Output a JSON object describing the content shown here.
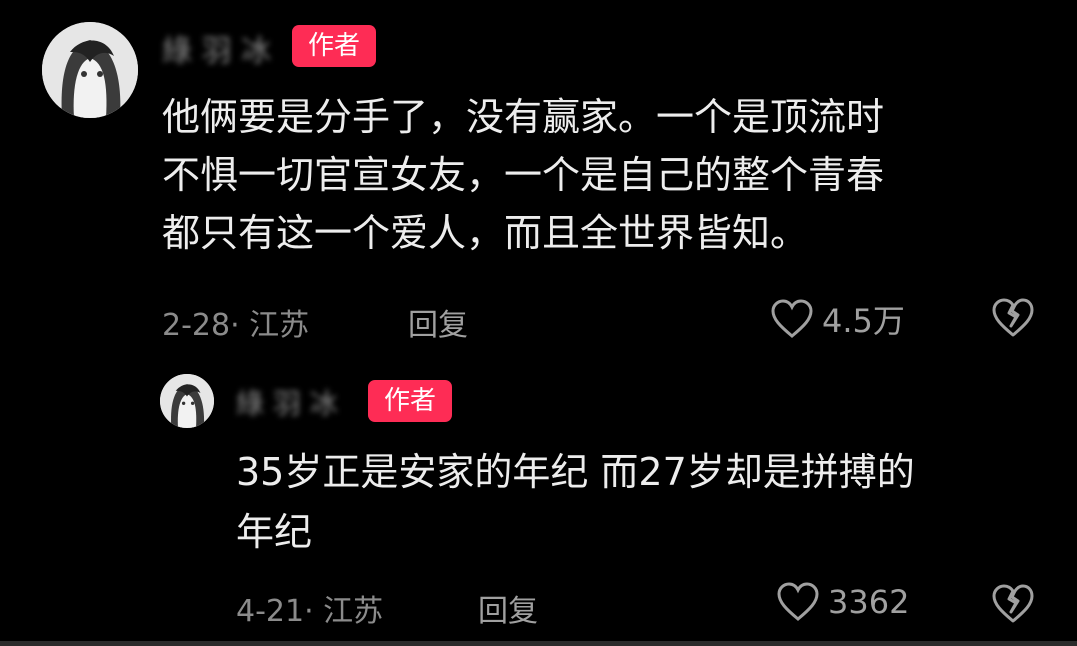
{
  "comments": [
    {
      "author": "綠 羽 冰",
      "author_badge": "作者",
      "text_lines": [
        "他俩要是分手了，没有赢家。一个是顶流时",
        "不惧一切官宣女友，一个是自己的整个青春",
        "都只有这一个爱人，而且全世界皆知。"
      ],
      "date_location": "2-28· 江苏",
      "reply_label": "回复",
      "like_count": "4.5万"
    },
    {
      "author": "綠 羽 冰",
      "author_badge": "作者",
      "text_lines": [
        "35岁正是安家的年纪 而27岁却是拼搏的",
        "年纪"
      ],
      "date_location": "4-21· 江苏",
      "reply_label": "回复",
      "like_count": "3362"
    }
  ],
  "colors": {
    "badge": "#fe2c55",
    "background": "#000000"
  },
  "icons": [
    "avatar",
    "heart-outline-icon",
    "broken-heart-icon"
  ]
}
